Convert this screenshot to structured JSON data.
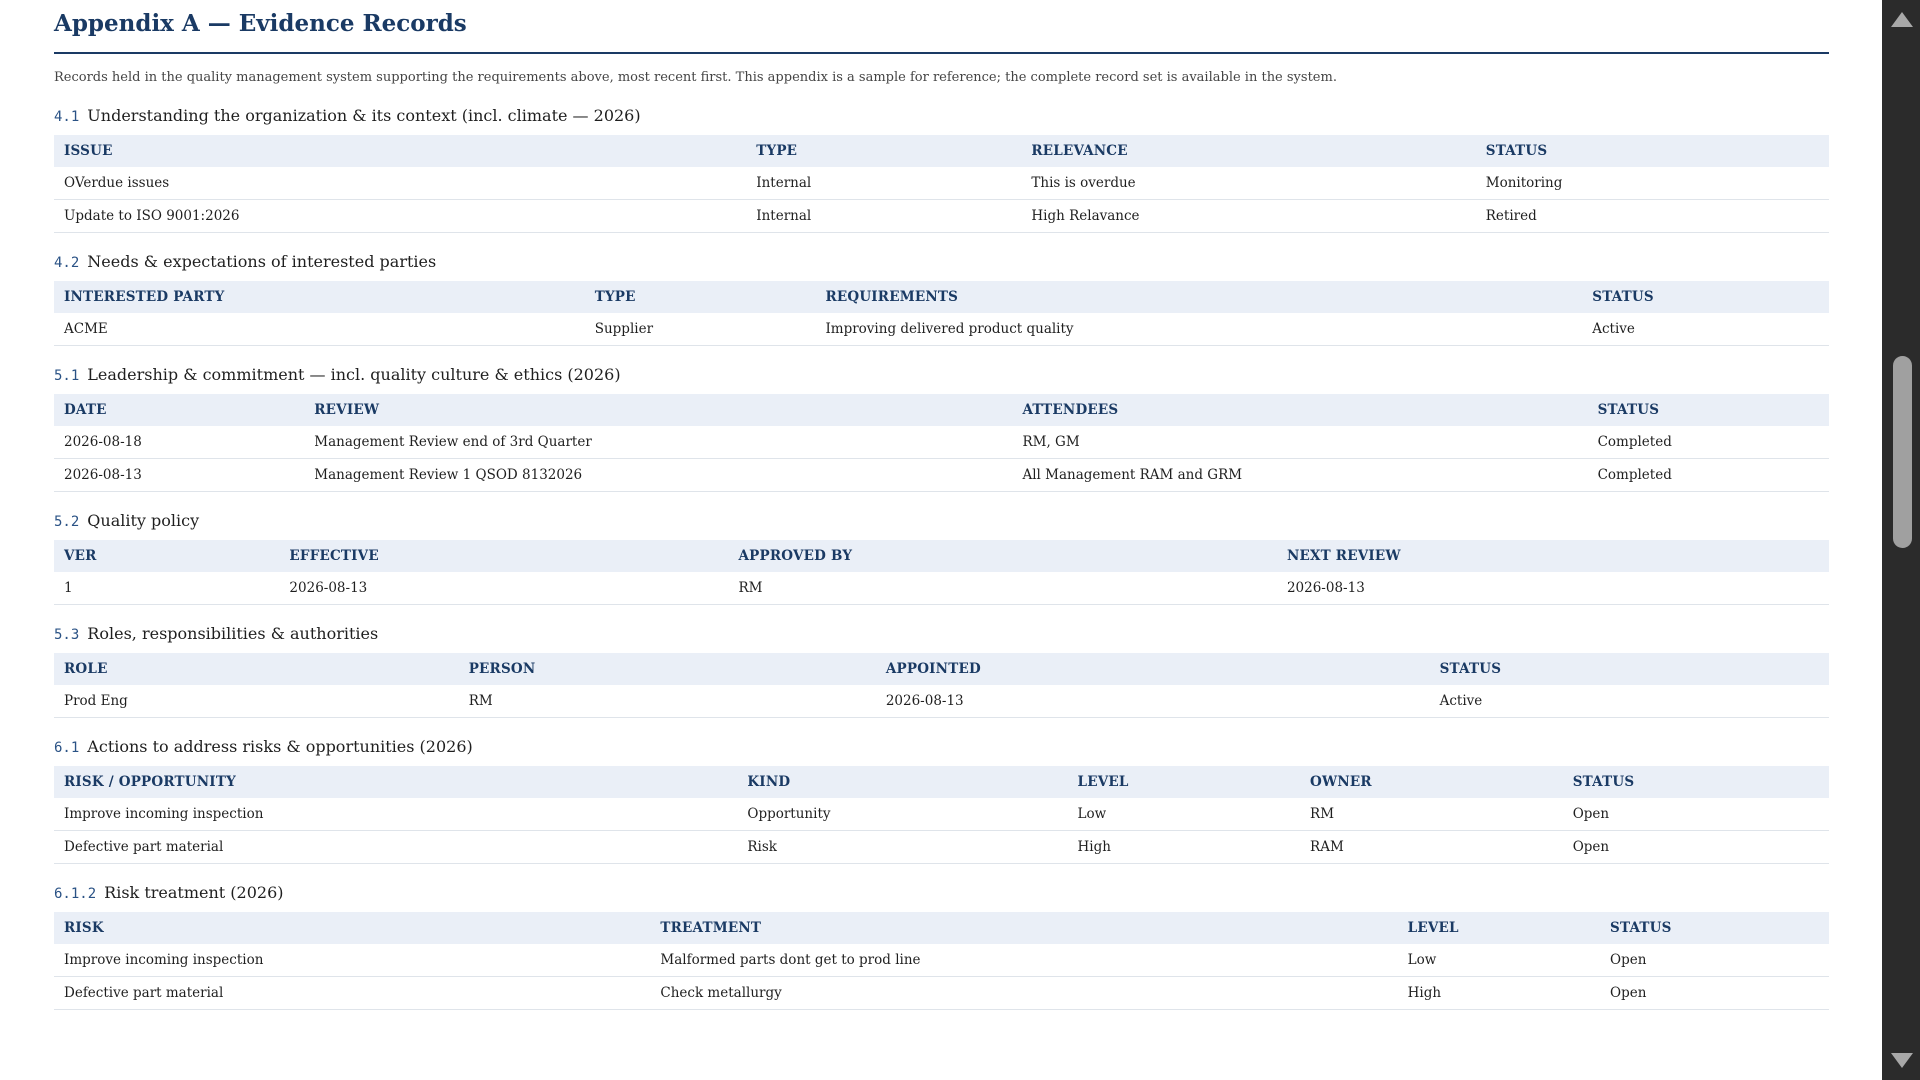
{
  "title": "Appendix A — Evidence Records",
  "intro": "Records held in the quality management system supporting the requirements above, most recent first. This appendix is a sample for reference; the complete record set is available in the system.",
  "sections": [
    {
      "number": "4.1",
      "title": "Understanding the organization & its context (incl. climate — 2026)",
      "columns": [
        "Issue",
        "Type",
        "Relevance",
        "Status"
      ],
      "rows": [
        [
          "OVerdue issues",
          "Internal",
          "This is overdue",
          "Monitoring"
        ],
        [
          "Update to ISO 9001:2026",
          "Internal",
          "High Relavance",
          "Retired"
        ]
      ]
    },
    {
      "number": "4.2",
      "title": "Needs & expectations of interested parties",
      "columns": [
        "Interested party",
        "Type",
        "Requirements",
        "Status"
      ],
      "rows": [
        [
          "ACME",
          "Supplier",
          "Improving delivered product quality",
          "Active"
        ]
      ]
    },
    {
      "number": "5.1",
      "title": "Leadership & commitment — incl. quality culture & ethics (2026)",
      "columns": [
        "Date",
        "Review",
        "Attendees",
        "Status"
      ],
      "rows": [
        [
          "2026-08-18",
          "Management Review end of 3rd Quarter",
          "RM, GM",
          "Completed"
        ],
        [
          "2026-08-13",
          "Management Review 1 QSOD 8132026",
          "All Management RAM and GRM",
          "Completed"
        ]
      ]
    },
    {
      "number": "5.2",
      "title": "Quality policy",
      "columns": [
        "Ver",
        "Effective",
        "Approved by",
        "Next review"
      ],
      "rows": [
        [
          "1",
          "2026-08-13",
          "RM",
          "2026-08-13"
        ]
      ]
    },
    {
      "number": "5.3",
      "title": "Roles, responsibilities & authorities",
      "columns": [
        "Role",
        "Person",
        "Appointed",
        "Status"
      ],
      "rows": [
        [
          "Prod Eng",
          "RM",
          "2026-08-13",
          "Active"
        ]
      ]
    },
    {
      "number": "6.1",
      "title": "Actions to address risks & opportunities (2026)",
      "columns": [
        "Risk / opportunity",
        "Kind",
        "Level",
        "Owner",
        "Status"
      ],
      "rows": [
        [
          "Improve incoming inspection",
          "Opportunity",
          "Low",
          "RM",
          "Open"
        ],
        [
          "Defective part material",
          "Risk",
          "High",
          "RAM",
          "Open"
        ]
      ]
    },
    {
      "number": "6.1.2",
      "title": "Risk treatment (2026)",
      "columns": [
        "Risk",
        "Treatment",
        "Level",
        "Status"
      ],
      "rows": [
        [
          "Improve incoming inspection",
          "Malformed parts dont get to prod line",
          "Low",
          "Open"
        ],
        [
          "Defective part material",
          "Check metallurgy",
          "High",
          "Open"
        ]
      ]
    }
  ]
}
